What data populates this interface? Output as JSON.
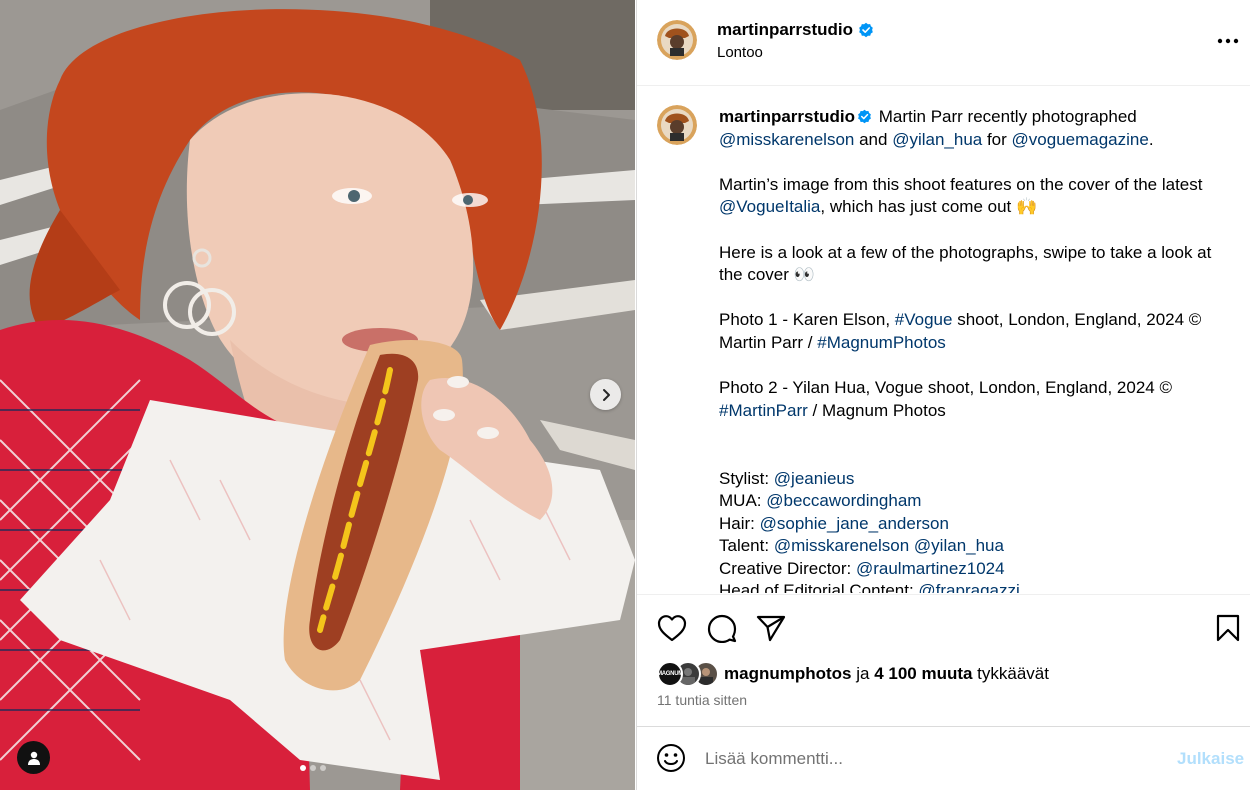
{
  "photo": {
    "alt": "Woman with red hair eating a hot dog",
    "carousel_index": 1,
    "carousel_count": 3
  },
  "header": {
    "username": "martinparrstudio",
    "verified": true,
    "location": "Lontoo",
    "more_icon": "more-horizontal-icon"
  },
  "caption": {
    "username": "martinparrstudio",
    "lines": {
      "p1_text": " Martin Parr recently photographed ",
      "p1_m1": "@misskarenelson",
      "p1_and": " and ",
      "p1_m2": "@yilan_hua",
      "p1_for": " for ",
      "p1_m3": "@voguemagazine",
      "p1_end": ".",
      "p2_text": "Martin’s image from this shoot features on the cover of the latest ",
      "p2_m1": "@VogueItalia",
      "p2_end": ", which has just come out 🙌",
      "p3": "Here is a look at a few of the photographs, swipe to take a look at the cover 👀",
      "p4_a": "Photo 1 - Karen Elson, ",
      "p4_tag1": "#Vogue",
      "p4_b": " shoot, London, England, 2024 © Martin Parr / ",
      "p4_tag2": "#MagnumPhotos",
      "p5_a": "Photo 2 - Yilan Hua, Vogue shoot, London, England, 2024 © ",
      "p5_tag": "#MartinParr",
      "p5_b": " / Magnum Photos",
      "credits": [
        {
          "label": "Stylist: ",
          "handles": [
            "@jeanieus"
          ]
        },
        {
          "label": "MUA: ",
          "handles": [
            "@beccawordingham"
          ]
        },
        {
          "label": "Hair: ",
          "handles": [
            "@sophie_jane_anderson"
          ]
        },
        {
          "label": "Talent: ",
          "handles": [
            "@misskarenelson",
            "@yilan_hua"
          ]
        },
        {
          "label": "Creative Director: ",
          "handles": [
            "@raulmartinez1024"
          ]
        },
        {
          "label": "Head of Editorial Content: ",
          "handles": [
            "@frapragazzi"
          ]
        }
      ]
    }
  },
  "actions": {
    "like_icon": "heart-icon",
    "comment_icon": "comment-icon",
    "share_icon": "send-icon",
    "save_icon": "bookmark-icon"
  },
  "likes": {
    "first_liker": "magnumphotos",
    "mid": " ja ",
    "others": "4 100 muuta",
    "end": " tykkäävät",
    "mini_avatar_1_text": "MAGNUM"
  },
  "timestamp": "11 tuntia sitten",
  "comment": {
    "placeholder": "Lisää kommentti...",
    "post_label": "Julkaise",
    "emoji_icon": "smiley-icon"
  },
  "colors": {
    "link": "#00376b",
    "verified": "#0095f6",
    "post_disabled": "#b2dffc"
  }
}
